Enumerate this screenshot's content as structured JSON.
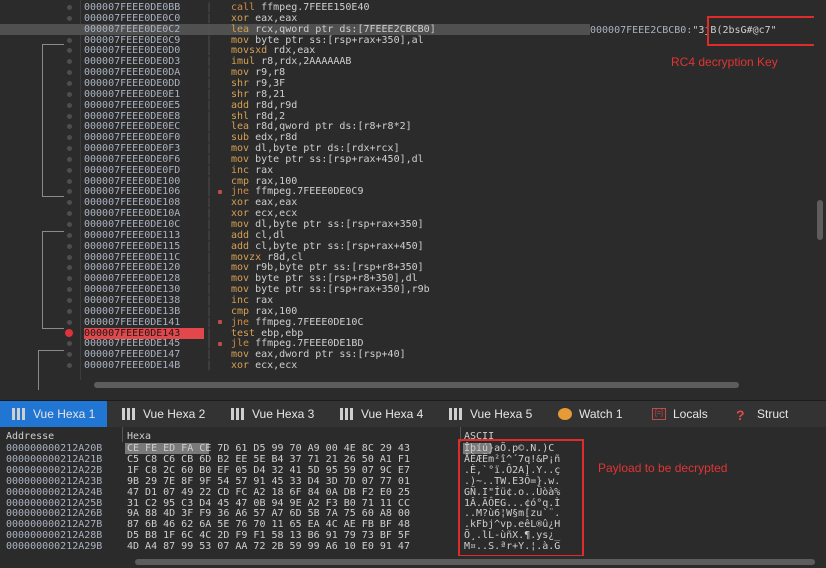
{
  "disasm": {
    "rows": [
      {
        "addr": "000007FEEE0DE0BB",
        "mn": "call",
        "ops": "ffmpeg.7FEEE150E40"
      },
      {
        "addr": "000007FEEE0DE0C0",
        "mn": "xor",
        "ops": "eax,eax"
      },
      {
        "addr": "000007FEEE0DE0C2",
        "mn": "lea",
        "ops": "rcx,qword ptr ds:[7FEEE2CBCB0]"
      },
      {
        "addr": "000007FEEE0DE0C9",
        "mn": "mov",
        "ops": "byte ptr ss:[rsp+rax+350],al"
      },
      {
        "addr": "000007FEEE0DE0D0",
        "mn": "movsxd",
        "ops": "rdx,eax"
      },
      {
        "addr": "000007FEEE0DE0D3",
        "mn": "imul",
        "ops": "r8,rdx,2AAAAAAB"
      },
      {
        "addr": "000007FEEE0DE0DA",
        "mn": "mov",
        "ops": "r9,r8"
      },
      {
        "addr": "000007FEEE0DE0DD",
        "mn": "shr",
        "ops": "r9,3F"
      },
      {
        "addr": "000007FEEE0DE0E1",
        "mn": "shr",
        "ops": "r8,21"
      },
      {
        "addr": "000007FEEE0DE0E5",
        "mn": "add",
        "ops": "r8d,r9d"
      },
      {
        "addr": "000007FEEE0DE0E8",
        "mn": "shl",
        "ops": "r8d,2"
      },
      {
        "addr": "000007FEEE0DE0EC",
        "mn": "lea",
        "ops": "r8d,qword ptr ds:[r8+r8*2]"
      },
      {
        "addr": "000007FEEE0DE0F0",
        "mn": "sub",
        "ops": "edx,r8d"
      },
      {
        "addr": "000007FEEE0DE0F3",
        "mn": "mov",
        "ops": "dl,byte ptr ds:[rdx+rcx]"
      },
      {
        "addr": "000007FEEE0DE0F6",
        "mn": "mov",
        "ops": "byte ptr ss:[rsp+rax+450],dl"
      },
      {
        "addr": "000007FEEE0DE0FD",
        "mn": "inc",
        "ops": "rax"
      },
      {
        "addr": "000007FEEE0DE100",
        "mn": "cmp",
        "ops": "rax,100"
      },
      {
        "addr": "000007FEEE0DE106",
        "mn": "jne",
        "ops": "ffmpeg.7FEEE0DE0C9"
      },
      {
        "addr": "000007FEEE0DE108",
        "mn": "xor",
        "ops": "eax,eax"
      },
      {
        "addr": "000007FEEE0DE10A",
        "mn": "xor",
        "ops": "ecx,ecx"
      },
      {
        "addr": "000007FEEE0DE10C",
        "mn": "mov",
        "ops": "dl,byte ptr ss:[rsp+rax+350]"
      },
      {
        "addr": "000007FEEE0DE113",
        "mn": "add",
        "ops": "cl,dl"
      },
      {
        "addr": "000007FEEE0DE115",
        "mn": "add",
        "ops": "cl,byte ptr ss:[rsp+rax+450]"
      },
      {
        "addr": "000007FEEE0DE11C",
        "mn": "movzx",
        "ops": "r8d,cl"
      },
      {
        "addr": "000007FEEE0DE120",
        "mn": "mov",
        "ops": "r9b,byte ptr ss:[rsp+r8+350]"
      },
      {
        "addr": "000007FEEE0DE128",
        "mn": "mov",
        "ops": "byte ptr ss:[rsp+r8+350],dl"
      },
      {
        "addr": "000007FEEE0DE130",
        "mn": "mov",
        "ops": "byte ptr ss:[rsp+rax+350],r9b"
      },
      {
        "addr": "000007FEEE0DE138",
        "mn": "inc",
        "ops": "rax"
      },
      {
        "addr": "000007FEEE0DE13B",
        "mn": "cmp",
        "ops": "rax,100"
      },
      {
        "addr": "000007FEEE0DE141",
        "mn": "jne",
        "ops": "ffmpeg.7FEEE0DE10C"
      },
      {
        "addr": "000007FEEE0DE143",
        "mn": "test",
        "ops": "ebp,ebp"
      },
      {
        "addr": "000007FEEE0DE145",
        "mn": "jle",
        "ops": "ffmpeg.7FEEE0DE1BD"
      },
      {
        "addr": "000007FEEE0DE147",
        "mn": "mov",
        "ops": "eax,dword ptr ss:[rsp+40]"
      },
      {
        "addr": "000007FEEE0DE14B",
        "mn": "xor",
        "ops": "ecx,ecx"
      }
    ],
    "key_comment_addr": "000007FEEE2CBCB0:",
    "key_comment_value": "\"3jB(2bsG#@c7\"",
    "key_label": "RC4 decryption Key"
  },
  "tabs": [
    {
      "label": "Vue Hexa 1",
      "icon": "hex-dump-icon"
    },
    {
      "label": "Vue Hexa 2",
      "icon": "hex-dump-icon"
    },
    {
      "label": "Vue Hexa 3",
      "icon": "hex-dump-icon"
    },
    {
      "label": "Vue Hexa 4",
      "icon": "hex-dump-icon"
    },
    {
      "label": "Vue Hexa 5",
      "icon": "hex-dump-icon"
    },
    {
      "label": "Watch 1",
      "icon": "watch-icon"
    },
    {
      "label": "Locals",
      "icon": "locals-icon"
    },
    {
      "label": "Struct",
      "icon": "struct-icon"
    }
  ],
  "hex": {
    "col_address": "Addresse",
    "col_hex": "Hexa",
    "col_ascii": "ASCII",
    "payload_label": "Payload to be decrypted",
    "rows": [
      {
        "addr": "000000000212A20B",
        "bytes": "CE FE ED FA CE 7D 61 D5 99 70 A9 00 4E 8C 29 43",
        "ascii": "Îþíú}aÕ.p©.N.)C"
      },
      {
        "addr": "000000000212A21B",
        "bytes": "C5 C8 C6 CB 6D B2 EE 5E B4 37 71 21 26 50 A1 F1",
        "ascii": "ÅÈÆËm²î^´7q!&P¡ñ"
      },
      {
        "addr": "000000000212A22B",
        "bytes": "1F C8 2C 60 B0 EF 05 D4 32 41 5D 95 59 07 9C E7",
        "ascii": ".È,`°ï.Ô2A].Y..ç"
      },
      {
        "addr": "000000000212A23B",
        "bytes": "9B 29 7E 8F 9F 54 57 91 45 33 D4 3D 7D 07 77 01",
        "ascii": ".)~..TW.E3Ô=}.w."
      },
      {
        "addr": "000000000212A24B",
        "bytes": "47 D1 07 49 22 CD FC A2 18 6F 84 0A DB F2 E0 25",
        "ascii": "GÑ.I\"Íü¢.o..Ûòà%"
      },
      {
        "addr": "000000000212A25B",
        "bytes": "31 C2 95 C3 D4 45 47 0B 94 9E A2 F3 B0 71 11 CC",
        "ascii": "1Â.ÃÔEG...¢ó°q.Ì"
      },
      {
        "addr": "000000000212A26B",
        "bytes": "9A 88 4D 3F F9 36 A6 57 A7 6D 5B 7A 75 60 A8 00",
        "ascii": "..M?ù6¦W§m[zu`¨."
      },
      {
        "addr": "000000000212A27B",
        "bytes": "87 6B 46 62 6A 5E 76 70 11 65 EA 4C AE FB BF 48",
        "ascii": ".kFbj^vp.eêL®û¿H"
      },
      {
        "addr": "000000000212A28B",
        "bytes": "D5 B8 1F 6C 4C 2D F9 F1 58 13 B6 91 79 73 BF 5F",
        "ascii": "Õ¸.lL-ùñX.¶.ys¿_"
      },
      {
        "addr": "000000000212A29B",
        "bytes": "4D A4 87 99 53 07 AA 72 2B 59 99 A6 10 E0 91 47",
        "ascii": "M¤..S.ªr+Y.¦.à.G"
      }
    ]
  }
}
